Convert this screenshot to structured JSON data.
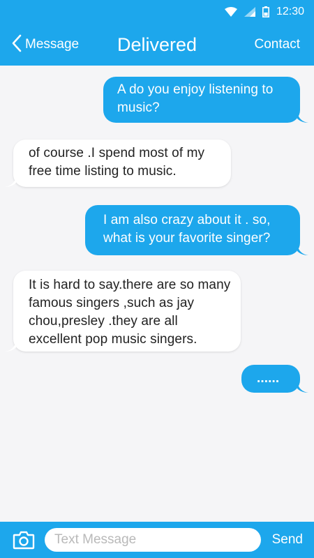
{
  "status_bar": {
    "time": "12:30",
    "icons": [
      "wifi-icon",
      "signal-icon",
      "battery-icon"
    ]
  },
  "nav": {
    "back_label": "Message",
    "title": "Delivered",
    "contact_label": "Contact"
  },
  "messages": [
    {
      "direction": "outgoing",
      "text": "A do you enjoy listening to music?"
    },
    {
      "direction": "incoming",
      "text": "of course .I spend most of my free time listing to music."
    },
    {
      "direction": "outgoing",
      "text": "I am also crazy about it . so, what is your favorite singer?"
    },
    {
      "direction": "incoming",
      "text": "It is hard to say.there are so many famous singers ,such as jay chou,presley .they are all excellent pop music singers."
    },
    {
      "direction": "outgoing",
      "text": "......"
    }
  ],
  "input_bar": {
    "placeholder": "Text Message",
    "value": "",
    "send_label": "Send",
    "camera_icon": "camera-icon"
  },
  "colors": {
    "accent": "#1da7ec",
    "background": "#f5f5f7",
    "incoming_bubble": "#ffffff",
    "incoming_text": "#222222"
  }
}
